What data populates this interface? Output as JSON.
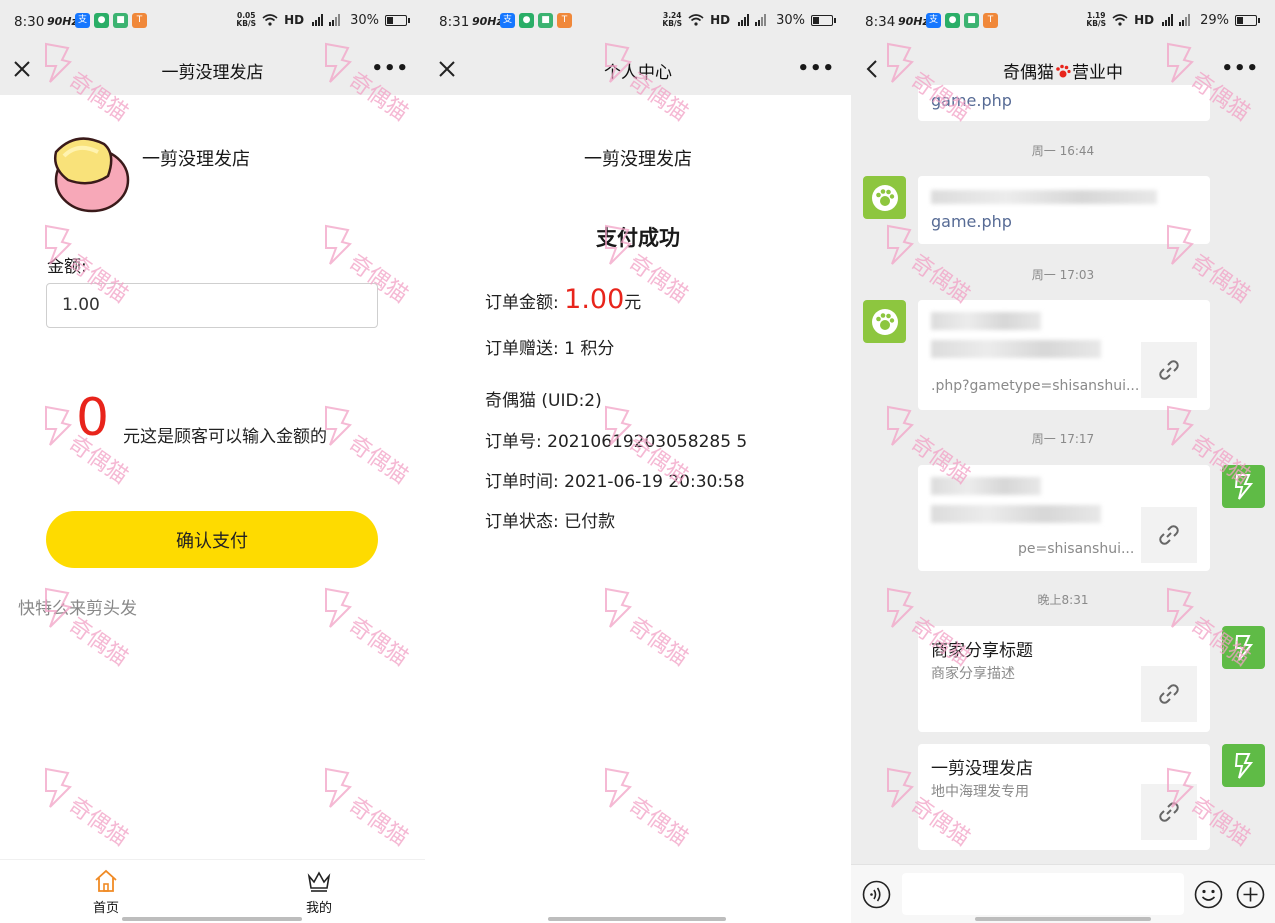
{
  "panel1": {
    "status": {
      "time": "8:30",
      "hz": "90Hz",
      "speed": "0.05",
      "speed_unit": "KB/S",
      "net": "HD",
      "battery": "30%"
    },
    "nav": {
      "title": "一剪没理发店"
    },
    "shop_name": "一剪没理发店",
    "amount_label": "金额:",
    "amount_value": "1.00",
    "points_value": "0",
    "points_desc": "元这是顾客可以输入金额的",
    "pay_button": "确认支付",
    "slogan": "快特么来剪头发",
    "tabs": [
      {
        "label": "首页"
      },
      {
        "label": "我的"
      }
    ]
  },
  "panel2": {
    "status": {
      "time": "8:31",
      "hz": "90Hz",
      "speed": "3.24",
      "speed_unit": "KB/S",
      "net": "HD",
      "battery": "30%"
    },
    "nav": {
      "title": "个人中心"
    },
    "shop_name": "一剪没理发店",
    "result_title": "支付成功",
    "order_amount_label": "订单金额:",
    "order_amount_value": "1.00",
    "order_amount_unit": "元",
    "order_gift_label": "订单赠送:",
    "order_gift_value": "1 积分",
    "user_line": "奇偶猫 (UID:2)",
    "order_no_label": "订单号:",
    "order_no_value": "20210619203058285 5",
    "order_time_label": "订单时间:",
    "order_time_value": "2021-06-19 20:30:58",
    "order_status_label": "订单状态:",
    "order_status_value": "已付款"
  },
  "panel3": {
    "status": {
      "time": "8:34",
      "hz": "90Hz",
      "speed": "1.19",
      "speed_unit": "KB/S",
      "net": "HD",
      "battery": "29%"
    },
    "nav": {
      "title_left": "奇偶猫",
      "title_right": "营业中"
    },
    "messages": [
      {
        "link": "game.php"
      },
      {
        "time": "周一 16:44",
        "link": "game.php"
      },
      {
        "time": "周一 17:03",
        "desc": ".php?gametype=shisanshui..."
      },
      {
        "time": "周一 17:17",
        "desc": "pe=shisanshui..."
      },
      {
        "time": "晚上8:31",
        "title": "商家分享标题",
        "desc": "商家分享描述"
      },
      {
        "title": "一剪没理发店",
        "desc": "地中海理发专用"
      }
    ]
  },
  "watermark_text": "奇偶猫",
  "colors": {
    "accent_yellow": "#fedb00",
    "price_red": "#e8241b",
    "wechat_green": "#5fbb46",
    "link_blue": "#576b95"
  }
}
